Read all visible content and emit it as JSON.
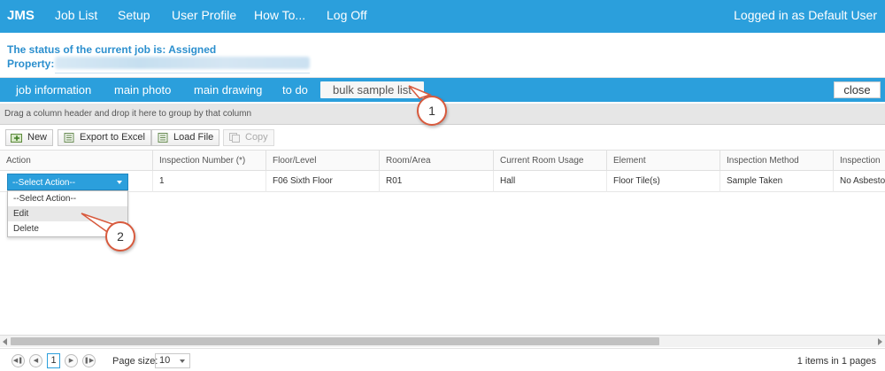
{
  "nav": {
    "brand": "JMS",
    "items": [
      "Job List",
      "Setup",
      "User Profile",
      "How To...",
      "Log Off"
    ],
    "login": "Logged in as Default User"
  },
  "status": {
    "line1": "The status of the current job is: Assigned",
    "property_label": "Property:"
  },
  "tabs": {
    "items": [
      "job information",
      "main photo",
      "main drawing",
      "to do",
      "bulk sample list"
    ],
    "active": "bulk sample list",
    "close_label": "close"
  },
  "group_hint": "Drag a column header and drop it here to group by that column",
  "toolbar": {
    "new_label": "New",
    "export_label": "Export to Excel",
    "load_label": "Load File",
    "copy_label": "Copy"
  },
  "grid": {
    "columns": [
      "Action",
      "Inspection Number (*)",
      "Floor/Level",
      "Room/Area",
      "Current Room Usage",
      "Element",
      "Inspection Method",
      "Inspection"
    ],
    "rows": [
      [
        "--Select Action--",
        "1",
        "F06 Sixth Floor",
        "R01",
        "Hall",
        "Floor Tile(s)",
        "Sample Taken",
        "No Asbesto"
      ]
    ]
  },
  "action_dropdown": {
    "selected": "--Select Action--",
    "options": [
      "--Select Action--",
      "Edit",
      "Delete"
    ],
    "hovered": "Edit"
  },
  "callouts": [
    "1",
    "2"
  ],
  "pager": {
    "current_page": "1",
    "page_size_label": "Page size:",
    "page_size": "10",
    "info": "1 items in 1 pages"
  },
  "colors": {
    "primary": "#2b9fdc",
    "status_text": "#2b8fce",
    "callout_border": "#d85a3d"
  }
}
